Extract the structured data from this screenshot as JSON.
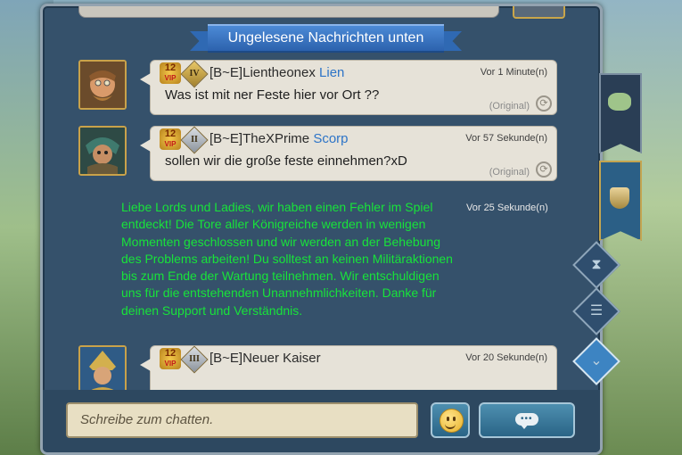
{
  "banner": {
    "label": "Ungelesene Nachrichten unten"
  },
  "messages": [
    {
      "vip_level": "12",
      "vip_label": "VIP",
      "rank": "IV",
      "sender": "[B~E]Lientheonex",
      "title": "Lien",
      "time": "Vor 1 Minute(n)",
      "text": "Was ist mit ner Feste hier vor Ort ??",
      "original": "(Original)"
    },
    {
      "vip_level": "12",
      "vip_label": "VIP",
      "rank": "II",
      "sender": "[B~E]TheXPrime",
      "title": "Scorp",
      "time": "Vor 57 Sekunde(n)",
      "text": "sollen wir die große feste einnehmen?xD",
      "original": "(Original)"
    },
    {
      "vip_level": "12",
      "vip_label": "VIP",
      "rank": "III",
      "sender": "[B~E]Neuer Kaiser",
      "title": "",
      "time": "Vor 20 Sekunde(n)",
      "text": "",
      "original": ""
    }
  ],
  "system_message": {
    "time": "Vor 25 Sekunde(n)",
    "text": "Liebe Lords und Ladies, wir haben einen Fehler im Spiel entdeckt!  Die Tore aller Königreiche werden in wenigen Momenten geschlossen und wir werden an der Behebung des Problems arbeiten!  Du solltest an keinen Militäraktionen bis zum Ende der Wartung teilnehmen. Wir entschuldigen uns für die entstehenden Unannehmlichkeiten. Danke für deinen Support und Verständnis."
  },
  "input": {
    "placeholder": "Schreibe zum chatten."
  },
  "colors": {
    "system_text": "#18e33a",
    "title_blue": "#2d74c7",
    "banner_blue": "#2f69b3",
    "panel": "#35516b"
  },
  "side_tabs": [
    "map-banner-icon",
    "guild-emblem-icon",
    "hourglass-icon",
    "list-icon",
    "chevron-down-icon"
  ]
}
